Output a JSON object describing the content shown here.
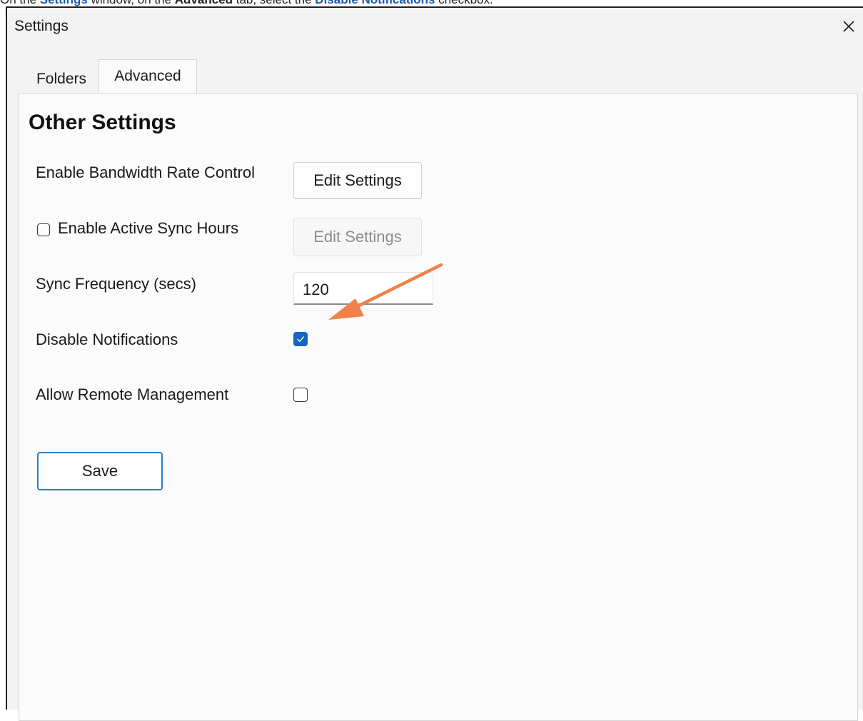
{
  "instruction": {
    "prefix": "On the ",
    "window_name": "Settings",
    "mid1": " window, on the ",
    "tab_name": "Advanced",
    "mid2": " tab, select the ",
    "target": "Disable Notifications",
    "suffix": " checkbox."
  },
  "window": {
    "title": "Settings",
    "close_glyph": "✕"
  },
  "tabs": [
    {
      "label": "Folders",
      "active": false
    },
    {
      "label": "Advanced",
      "active": true
    }
  ],
  "panel": {
    "section_title": "Other Settings",
    "bandwidth": {
      "label": "Enable Bandwidth Rate Control",
      "button": "Edit Settings"
    },
    "sync_hours": {
      "label": "Enable Active Sync Hours",
      "button": "Edit Settings",
      "checked": false,
      "button_disabled": true
    },
    "sync_frequency": {
      "label": "Sync Frequency (secs)",
      "value": "120"
    },
    "disable_notifications": {
      "label": "Disable Notifications",
      "checked": true
    },
    "remote_management": {
      "label": "Allow Remote Management",
      "checked": false
    },
    "save_label": "Save"
  },
  "colors": {
    "accent": "#1763c4",
    "annotation_arrow": "#f2804a"
  }
}
